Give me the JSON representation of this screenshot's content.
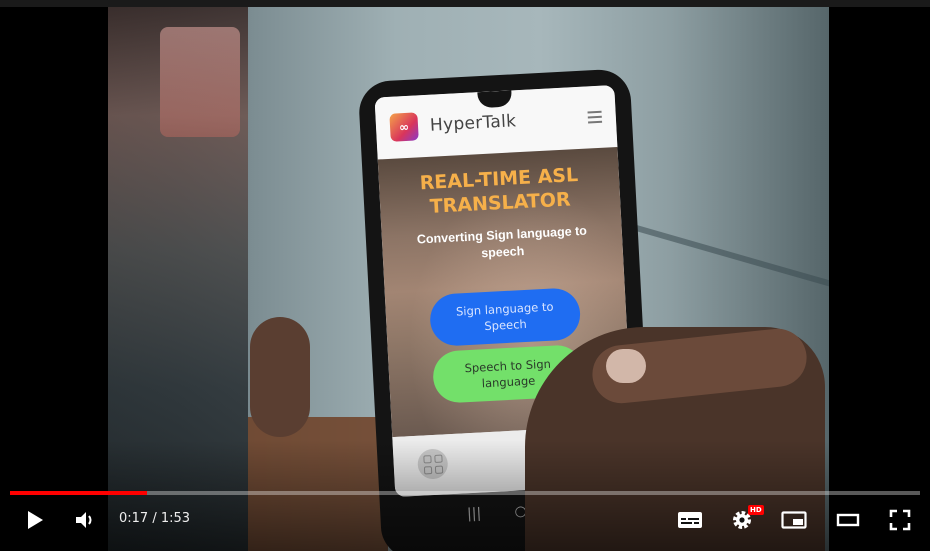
{
  "video": {
    "app": {
      "name": "HyperTalk",
      "hero_title_line1": "REAL-TIME ASL",
      "hero_title_line2": "TRANSLATOR",
      "hero_subtitle": "Converting Sign language to speech",
      "button_sign_to_speech": "Sign language to Speech",
      "button_speech_to_sign": "Speech to Sign language",
      "title_color": "#f6b04a",
      "primary_button_color": "#1f6df2",
      "secondary_button_color": "#73e06a"
    }
  },
  "player": {
    "current_time": "0:17",
    "duration": "1:53",
    "time_display": "0:17 / 1:53",
    "progress_fraction": 0.15,
    "quality_badge": "HD",
    "accent_color": "#ff0000",
    "icons": [
      "play-icon",
      "volume-icon",
      "captions-icon",
      "settings-icon",
      "miniplayer-icon",
      "theater-icon",
      "fullscreen-icon"
    ]
  }
}
